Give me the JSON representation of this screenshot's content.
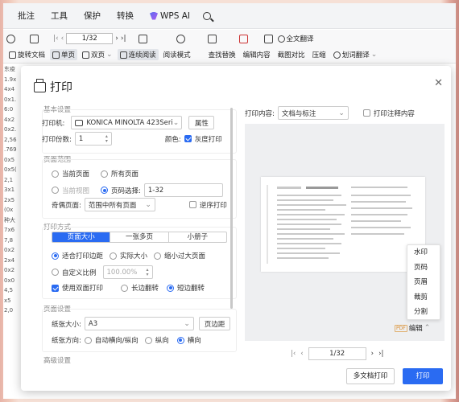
{
  "menubar": {
    "items": [
      "批注",
      "工具",
      "保护",
      "转换"
    ],
    "wps_ai": "WPS AI"
  },
  "toolbar": {
    "page_value": "1/32",
    "full_translate": "全文翻译",
    "row2": [
      "旋转文档",
      "单页",
      "双页",
      "连续阅读",
      "阅读模式",
      "查找替换",
      "编辑内容",
      "截图对比",
      "压缩",
      "划词翻译"
    ]
  },
  "docstrip": [
    "东疫",
    "1.9x",
    "4x4",
    "0x1.",
    "6:0",
    "4x2",
    "0x2.",
    "2,56",
    ".769",
    "0x5",
    "0x5(",
    "2,1",
    "3x1",
    "2x5",
    "(0x",
    "种大",
    "7x6",
    "7,8",
    "0x2",
    "2x4",
    "0x2",
    "0x0",
    "4,5",
    "x5",
    "2,0"
  ],
  "dialog": {
    "title": "打印",
    "basic": {
      "section_title": "基本设置",
      "printer_label": "打印机:",
      "printer_value": "KONICA MINOLTA 423Seri",
      "properties_btn": "属性",
      "copies_label": "打印份数:",
      "copies_value": "1",
      "color_label": "颜色:",
      "grayscale_label": "灰度打印"
    },
    "range": {
      "section_title": "页面范围",
      "current_page": "当前页面",
      "all_pages": "所有页面",
      "current_view": "当前视图",
      "page_select_label": "页码选择:",
      "page_select_value": "1-32",
      "odd_even_label": "奇偶页面:",
      "odd_even_value": "范围中所有页面",
      "reverse_print": "逆序打印"
    },
    "method": {
      "section_title": "打印方式",
      "tabs": [
        "页面大小",
        "一张多页",
        "小册子"
      ],
      "fit_margin": "适合打印边距",
      "actual_size": "实际大小",
      "shrink_large": "缩小过大页面",
      "custom_scale": "自定义比例",
      "scale_value": "100.00%",
      "duplex": "使用双面打印",
      "long_edge": "长边翻转",
      "short_edge": "短边翻转"
    },
    "page_setup": {
      "section_title": "页面设置",
      "paper_size_label": "纸张大小:",
      "paper_size_value": "A3",
      "margin_btn": "页边距",
      "orientation_label": "纸张方向:",
      "auto_orient": "自动横向/纵向",
      "portrait": "纵向",
      "landscape": "横向"
    },
    "advanced": {
      "section_title": "高级设置"
    },
    "preview": {
      "content_label": "打印内容:",
      "content_value": "文档与标注",
      "print_annotations": "打印注释内容",
      "context_menu": [
        "水印",
        "页码",
        "页眉",
        "裁剪",
        "分割"
      ],
      "pdf_tag": "PDF",
      "edit_label": "编辑",
      "page_value": "1/32"
    },
    "multi_doc_btn": "多文档打印",
    "print_btn": "打印"
  }
}
